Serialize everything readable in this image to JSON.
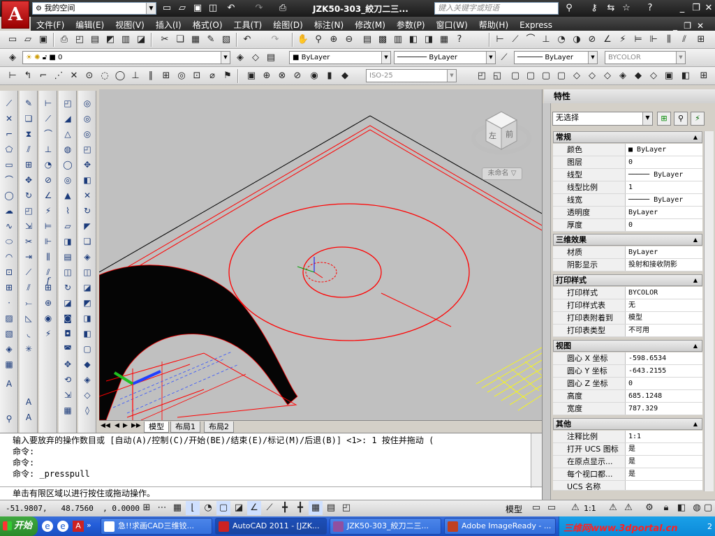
{
  "titlebar": {
    "workspace": "我的空间",
    "doc_title": "JZK50-303_絞刀二三...",
    "search_placeholder": "键入关键字或短语"
  },
  "menu": [
    "文件(F)",
    "编辑(E)",
    "视图(V)",
    "插入(I)",
    "格式(O)",
    "工具(T)",
    "绘图(D)",
    "标注(N)",
    "修改(M)",
    "参数(P)",
    "窗口(W)",
    "帮助(H)",
    "Express"
  ],
  "layers_toolbar": {
    "layer_value": "0",
    "color_value": "ByLayer",
    "linetype_value": "ByLayer",
    "lineweight_value": "ByLayer",
    "plotstyle_value": "BYCOLOR"
  },
  "dim_toolbar": {
    "dimstyle_value": "ISO-25"
  },
  "viewcube": {
    "face_top": "前",
    "face_left": "左",
    "view_label": "未命名"
  },
  "layout_tabs": [
    "模型",
    "布局1",
    "布局2"
  ],
  "properties": {
    "title": "特性",
    "selection": "无选择",
    "sections": [
      {
        "title": "常规",
        "rows": [
          {
            "key": "颜色",
            "value": "ByLayer"
          },
          {
            "key": "图层",
            "value": "0"
          },
          {
            "key": "线型",
            "value": "ByLayer"
          },
          {
            "key": "线型比例",
            "value": "1"
          },
          {
            "key": "线宽",
            "value": "ByLayer"
          },
          {
            "key": "透明度",
            "value": "ByLayer"
          },
          {
            "key": "厚度",
            "value": "0"
          }
        ]
      },
      {
        "title": "三维效果",
        "rows": [
          {
            "key": "材质",
            "value": "ByLayer"
          },
          {
            "key": "阴影显示",
            "value": "投射和接收阴影"
          }
        ]
      },
      {
        "title": "打印样式",
        "rows": [
          {
            "key": "打印样式",
            "value": "BYCOLOR"
          },
          {
            "key": "打印样式表",
            "value": "无"
          },
          {
            "key": "打印表附着到",
            "value": "模型"
          },
          {
            "key": "打印表类型",
            "value": "不可用"
          }
        ]
      },
      {
        "title": "视图",
        "rows": [
          {
            "key": "圆心 X 坐标",
            "value": "-598.6534"
          },
          {
            "key": "圆心 Y 坐标",
            "value": "-643.2155"
          },
          {
            "key": "圆心 Z 坐标",
            "value": "0"
          },
          {
            "key": "高度",
            "value": "685.1248"
          },
          {
            "key": "宽度",
            "value": "787.329"
          }
        ]
      },
      {
        "title": "其他",
        "rows": [
          {
            "key": "注释比例",
            "value": "1:1"
          },
          {
            "key": "打开 UCS 图标",
            "value": "是"
          },
          {
            "key": "在原点显示...",
            "value": "是"
          },
          {
            "key": "每个视口都...",
            "value": "是"
          },
          {
            "key": "UCS 名称",
            "value": ""
          }
        ]
      }
    ]
  },
  "command": {
    "lines": [
      "输入要放弃的操作数目或 [自动(A)/控制(C)/开始(BE)/结束(E)/标记(M)/后退(B)] <1>: 1 按住并拖动 (",
      "命令:",
      "命令:",
      "命令: _presspull"
    ],
    "prompt": "单击有限区域以进行按住或拖动操作。"
  },
  "status": {
    "coords": "-51.9807,   48.7560  , 0.0000",
    "model_label": "模型",
    "annoscale": "1:1"
  },
  "taskbar": {
    "start_label": "开始",
    "tasks": [
      "急!!求画CAD三维铰...",
      "AutoCAD 2011 - [JZK...",
      "JZK50-303_絞刀二三...",
      "Adobe ImageReady - ..."
    ],
    "watermark": "三维网www.3dportal.cn",
    "clock": "2"
  },
  "colors": {
    "accent_red": "#ff0000",
    "taskbar_blue": "#245edb",
    "titlebar_dark": "#222222"
  }
}
